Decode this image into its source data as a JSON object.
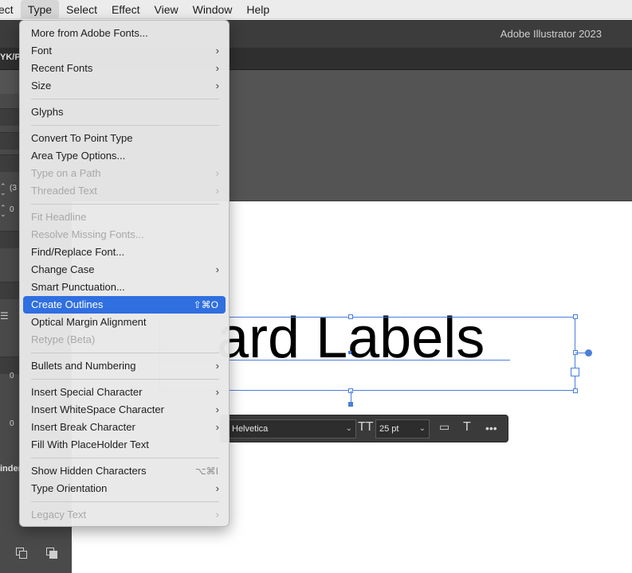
{
  "menubar": {
    "items": [
      "ect",
      "Type",
      "Select",
      "Effect",
      "View",
      "Window",
      "Help"
    ]
  },
  "app": {
    "title": "Adobe Illustrator 2023",
    "doc_tab": "YK/P"
  },
  "left_panel": {
    "field_values": [
      "(3",
      "0",
      "0",
      "0"
    ],
    "label": "inder"
  },
  "menu": {
    "items": [
      {
        "label": "More from Adobe Fonts...",
        "enabled": true,
        "submenu": false,
        "shortcut": ""
      },
      {
        "label": "Font",
        "enabled": true,
        "submenu": true,
        "shortcut": ""
      },
      {
        "label": "Recent Fonts",
        "enabled": true,
        "submenu": true,
        "shortcut": ""
      },
      {
        "label": "Size",
        "enabled": true,
        "submenu": true,
        "shortcut": ""
      },
      {
        "label": "Glyphs",
        "enabled": true,
        "submenu": false,
        "shortcut": ""
      },
      {
        "label": "Convert To Point Type",
        "enabled": true,
        "submenu": false,
        "shortcut": ""
      },
      {
        "label": "Area Type Options...",
        "enabled": true,
        "submenu": false,
        "shortcut": ""
      },
      {
        "label": "Type on a Path",
        "enabled": false,
        "submenu": true,
        "shortcut": ""
      },
      {
        "label": "Threaded Text",
        "enabled": false,
        "submenu": true,
        "shortcut": ""
      },
      {
        "label": "Fit Headline",
        "enabled": false,
        "submenu": false,
        "shortcut": ""
      },
      {
        "label": "Resolve Missing Fonts...",
        "enabled": false,
        "submenu": false,
        "shortcut": ""
      },
      {
        "label": "Find/Replace Font...",
        "enabled": true,
        "submenu": false,
        "shortcut": ""
      },
      {
        "label": "Change Case",
        "enabled": true,
        "submenu": true,
        "shortcut": ""
      },
      {
        "label": "Smart Punctuation...",
        "enabled": true,
        "submenu": false,
        "shortcut": ""
      },
      {
        "label": "Create Outlines",
        "enabled": true,
        "submenu": false,
        "shortcut": "⇧⌘O",
        "highlighted": true
      },
      {
        "label": "Optical Margin Alignment",
        "enabled": true,
        "submenu": false,
        "shortcut": ""
      },
      {
        "label": "Retype (Beta)",
        "enabled": false,
        "submenu": false,
        "shortcut": ""
      },
      {
        "label": "Bullets and Numbering",
        "enabled": true,
        "submenu": true,
        "shortcut": ""
      },
      {
        "label": "Insert Special Character",
        "enabled": true,
        "submenu": true,
        "shortcut": ""
      },
      {
        "label": "Insert WhiteSpace Character",
        "enabled": true,
        "submenu": true,
        "shortcut": ""
      },
      {
        "label": "Insert Break Character",
        "enabled": true,
        "submenu": true,
        "shortcut": ""
      },
      {
        "label": "Fill With PlaceHolder Text",
        "enabled": true,
        "submenu": false,
        "shortcut": ""
      },
      {
        "label": "Show Hidden Characters",
        "enabled": true,
        "submenu": false,
        "shortcut": "⌥⌘I"
      },
      {
        "label": "Type Orientation",
        "enabled": true,
        "submenu": true,
        "shortcut": ""
      },
      {
        "label": "Legacy Text",
        "enabled": false,
        "submenu": true,
        "shortcut": ""
      }
    ]
  },
  "canvas": {
    "text": "ard Labels"
  },
  "taskbar": {
    "font": "Helvetica",
    "size": "25 pt"
  },
  "colors": {
    "highlight": "#2f6fe0",
    "selection": "#4a7fdb"
  }
}
